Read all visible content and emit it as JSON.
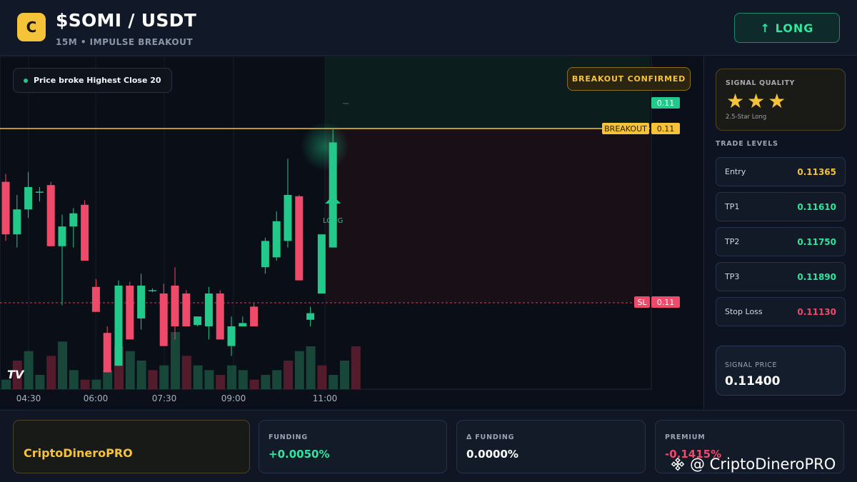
{
  "header": {
    "logo_letter": "C",
    "pair": "$SOMI / USDT",
    "subtitle": "15M • IMPULSE BREAKOUT",
    "direction_button": "↑ LONG"
  },
  "chart_overlay": {
    "info_pill": "Price broke Highest Close 20",
    "badge": "BREAKOUT CONFIRMED",
    "breakout_tag": "BREAKOUT",
    "breakout_price": "0.11",
    "last_price": "0.11",
    "sl_tag": "SL",
    "sl_price": "0.11",
    "signal_marker": "LONG",
    "tv_logo": "TV"
  },
  "chart_data": {
    "type": "candlestick",
    "x_ticks": [
      "04:30",
      "06:00",
      "07:30",
      "09:00",
      "11:00"
    ],
    "candles": [
      {
        "o": 0.1142,
        "h": 0.11432,
        "l": 0.1133,
        "c": 0.1134
      },
      {
        "o": 0.1134,
        "h": 0.114,
        "l": 0.1132,
        "c": 0.11378
      },
      {
        "o": 0.11378,
        "h": 0.11435,
        "l": 0.11365,
        "c": 0.11412
      },
      {
        "o": 0.11405,
        "h": 0.11412,
        "l": 0.1139,
        "c": 0.11405
      },
      {
        "o": 0.11415,
        "h": 0.1142,
        "l": 0.11322,
        "c": 0.11322
      },
      {
        "o": 0.11322,
        "h": 0.1137,
        "l": 0.11232,
        "c": 0.11352
      },
      {
        "o": 0.11352,
        "h": 0.1138,
        "l": 0.1132,
        "c": 0.11372
      },
      {
        "o": 0.11385,
        "h": 0.11392,
        "l": 0.113,
        "c": 0.113
      },
      {
        "o": 0.1126,
        "h": 0.11272,
        "l": 0.11222,
        "c": 0.11222
      },
      {
        "o": 0.1119,
        "h": 0.112,
        "l": 0.1113,
        "c": 0.1113
      },
      {
        "o": 0.1114,
        "h": 0.1127,
        "l": 0.1114,
        "c": 0.11262
      },
      {
        "o": 0.11262,
        "h": 0.11268,
        "l": 0.1118,
        "c": 0.1118
      },
      {
        "o": 0.11212,
        "h": 0.1128,
        "l": 0.11195,
        "c": 0.11262
      },
      {
        "o": 0.11255,
        "h": 0.11258,
        "l": 0.11252,
        "c": 0.11255
      },
      {
        "o": 0.1125,
        "h": 0.11265,
        "l": 0.1117,
        "c": 0.1117
      },
      {
        "o": 0.11262,
        "h": 0.1129,
        "l": 0.1118,
        "c": 0.112
      },
      {
        "o": 0.1125,
        "h": 0.11255,
        "l": 0.112,
        "c": 0.112
      },
      {
        "o": 0.11202,
        "h": 0.11215,
        "l": 0.112,
        "c": 0.11215
      },
      {
        "o": 0.112,
        "h": 0.1126,
        "l": 0.1118,
        "c": 0.1125
      },
      {
        "o": 0.1125,
        "h": 0.11255,
        "l": 0.1118,
        "c": 0.1118
      },
      {
        "o": 0.1117,
        "h": 0.11215,
        "l": 0.11155,
        "c": 0.112
      },
      {
        "o": 0.112,
        "h": 0.11215,
        "l": 0.112,
        "c": 0.11205
      },
      {
        "o": 0.1123,
        "h": 0.11235,
        "l": 0.112,
        "c": 0.112
      },
      {
        "o": 0.1129,
        "h": 0.11335,
        "l": 0.1128,
        "c": 0.1133
      },
      {
        "o": 0.11305,
        "h": 0.11375,
        "l": 0.113,
        "c": 0.1136
      },
      {
        "o": 0.1133,
        "h": 0.11455,
        "l": 0.1132,
        "c": 0.114
      },
      {
        "o": 0.11398,
        "h": 0.114,
        "l": 0.1127,
        "c": 0.1127
      },
      {
        "o": 0.1121,
        "h": 0.1123,
        "l": 0.112,
        "c": 0.1122
      },
      {
        "o": 0.1125,
        "h": 0.113,
        "l": 0.1125,
        "c": 0.1134
      },
      {
        "o": 0.1132,
        "h": 0.115,
        "l": 0.1132,
        "c": 0.1148
      }
    ],
    "volumes": [
      2,
      6,
      8,
      3,
      7,
      10,
      4,
      2,
      2,
      4,
      9,
      8,
      6,
      4,
      5,
      12,
      7,
      5,
      4,
      3,
      5,
      4,
      2,
      3,
      4,
      6,
      8,
      9,
      5,
      3,
      6,
      9
    ],
    "breakout_level": 0.1142,
    "stop_level": 0.1113
  },
  "panel": {
    "quality_label": "SIGNAL QUALITY",
    "stars": "★★★",
    "quality_sub": "2.5-Star Long",
    "levels_label": "TRADE LEVELS",
    "levels": [
      {
        "name": "Entry",
        "value": "0.11365",
        "color": "#f5c33a"
      },
      {
        "name": "TP1",
        "value": "0.11610",
        "color": "#2ee6a0"
      },
      {
        "name": "TP2",
        "value": "0.11750",
        "color": "#2ee6a0"
      },
      {
        "name": "TP3",
        "value": "0.11890",
        "color": "#2ee6a0"
      },
      {
        "name": "Stop Loss",
        "value": "0.11130",
        "color": "#f04a6a"
      }
    ],
    "signal_price_label": "SIGNAL PRICE",
    "signal_price": "0.11400"
  },
  "footer": {
    "brand": "CriptoDineroPRO",
    "funding_label": "FUNDING",
    "funding_value": "+0.0050%",
    "delta_label": "Δ FUNDING",
    "delta_value": "0.0000%",
    "premium_label": "PREMIUM",
    "premium_value": "-0.1415%"
  },
  "watermark": "@ CriptoDineroPRO",
  "colors": {
    "up": "#22c98a",
    "down": "#f04a6a",
    "accent": "#f5c33a"
  }
}
